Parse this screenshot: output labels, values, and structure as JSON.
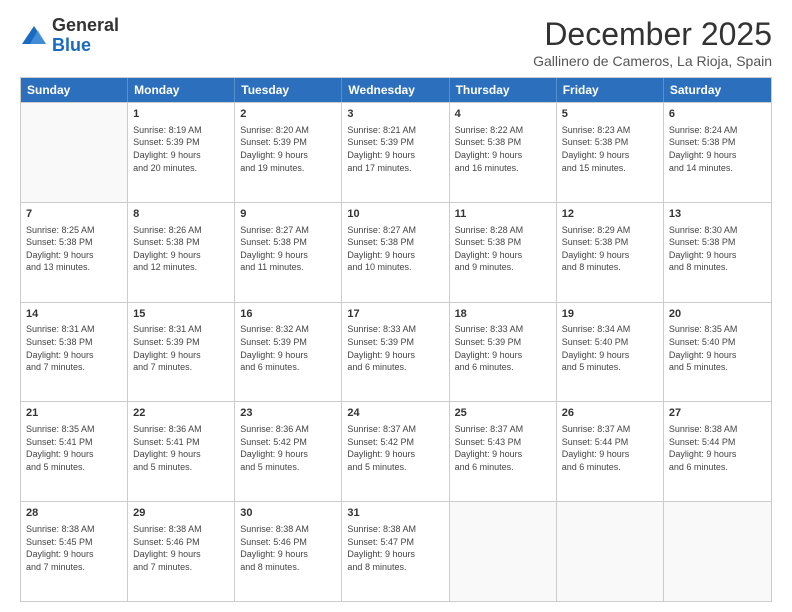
{
  "logo": {
    "general": "General",
    "blue": "Blue"
  },
  "title": "December 2025",
  "subtitle": "Gallinero de Cameros, La Rioja, Spain",
  "header_days": [
    "Sunday",
    "Monday",
    "Tuesday",
    "Wednesday",
    "Thursday",
    "Friday",
    "Saturday"
  ],
  "weeks": [
    [
      {
        "day": "",
        "info": ""
      },
      {
        "day": "1",
        "info": "Sunrise: 8:19 AM\nSunset: 5:39 PM\nDaylight: 9 hours\nand 20 minutes."
      },
      {
        "day": "2",
        "info": "Sunrise: 8:20 AM\nSunset: 5:39 PM\nDaylight: 9 hours\nand 19 minutes."
      },
      {
        "day": "3",
        "info": "Sunrise: 8:21 AM\nSunset: 5:39 PM\nDaylight: 9 hours\nand 17 minutes."
      },
      {
        "day": "4",
        "info": "Sunrise: 8:22 AM\nSunset: 5:38 PM\nDaylight: 9 hours\nand 16 minutes."
      },
      {
        "day": "5",
        "info": "Sunrise: 8:23 AM\nSunset: 5:38 PM\nDaylight: 9 hours\nand 15 minutes."
      },
      {
        "day": "6",
        "info": "Sunrise: 8:24 AM\nSunset: 5:38 PM\nDaylight: 9 hours\nand 14 minutes."
      }
    ],
    [
      {
        "day": "7",
        "info": "Sunrise: 8:25 AM\nSunset: 5:38 PM\nDaylight: 9 hours\nand 13 minutes."
      },
      {
        "day": "8",
        "info": "Sunrise: 8:26 AM\nSunset: 5:38 PM\nDaylight: 9 hours\nand 12 minutes."
      },
      {
        "day": "9",
        "info": "Sunrise: 8:27 AM\nSunset: 5:38 PM\nDaylight: 9 hours\nand 11 minutes."
      },
      {
        "day": "10",
        "info": "Sunrise: 8:27 AM\nSunset: 5:38 PM\nDaylight: 9 hours\nand 10 minutes."
      },
      {
        "day": "11",
        "info": "Sunrise: 8:28 AM\nSunset: 5:38 PM\nDaylight: 9 hours\nand 9 minutes."
      },
      {
        "day": "12",
        "info": "Sunrise: 8:29 AM\nSunset: 5:38 PM\nDaylight: 9 hours\nand 8 minutes."
      },
      {
        "day": "13",
        "info": "Sunrise: 8:30 AM\nSunset: 5:38 PM\nDaylight: 9 hours\nand 8 minutes."
      }
    ],
    [
      {
        "day": "14",
        "info": "Sunrise: 8:31 AM\nSunset: 5:38 PM\nDaylight: 9 hours\nand 7 minutes."
      },
      {
        "day": "15",
        "info": "Sunrise: 8:31 AM\nSunset: 5:39 PM\nDaylight: 9 hours\nand 7 minutes."
      },
      {
        "day": "16",
        "info": "Sunrise: 8:32 AM\nSunset: 5:39 PM\nDaylight: 9 hours\nand 6 minutes."
      },
      {
        "day": "17",
        "info": "Sunrise: 8:33 AM\nSunset: 5:39 PM\nDaylight: 9 hours\nand 6 minutes."
      },
      {
        "day": "18",
        "info": "Sunrise: 8:33 AM\nSunset: 5:39 PM\nDaylight: 9 hours\nand 6 minutes."
      },
      {
        "day": "19",
        "info": "Sunrise: 8:34 AM\nSunset: 5:40 PM\nDaylight: 9 hours\nand 5 minutes."
      },
      {
        "day": "20",
        "info": "Sunrise: 8:35 AM\nSunset: 5:40 PM\nDaylight: 9 hours\nand 5 minutes."
      }
    ],
    [
      {
        "day": "21",
        "info": "Sunrise: 8:35 AM\nSunset: 5:41 PM\nDaylight: 9 hours\nand 5 minutes."
      },
      {
        "day": "22",
        "info": "Sunrise: 8:36 AM\nSunset: 5:41 PM\nDaylight: 9 hours\nand 5 minutes."
      },
      {
        "day": "23",
        "info": "Sunrise: 8:36 AM\nSunset: 5:42 PM\nDaylight: 9 hours\nand 5 minutes."
      },
      {
        "day": "24",
        "info": "Sunrise: 8:37 AM\nSunset: 5:42 PM\nDaylight: 9 hours\nand 5 minutes."
      },
      {
        "day": "25",
        "info": "Sunrise: 8:37 AM\nSunset: 5:43 PM\nDaylight: 9 hours\nand 6 minutes."
      },
      {
        "day": "26",
        "info": "Sunrise: 8:37 AM\nSunset: 5:44 PM\nDaylight: 9 hours\nand 6 minutes."
      },
      {
        "day": "27",
        "info": "Sunrise: 8:38 AM\nSunset: 5:44 PM\nDaylight: 9 hours\nand 6 minutes."
      }
    ],
    [
      {
        "day": "28",
        "info": "Sunrise: 8:38 AM\nSunset: 5:45 PM\nDaylight: 9 hours\nand 7 minutes."
      },
      {
        "day": "29",
        "info": "Sunrise: 8:38 AM\nSunset: 5:46 PM\nDaylight: 9 hours\nand 7 minutes."
      },
      {
        "day": "30",
        "info": "Sunrise: 8:38 AM\nSunset: 5:46 PM\nDaylight: 9 hours\nand 8 minutes."
      },
      {
        "day": "31",
        "info": "Sunrise: 8:38 AM\nSunset: 5:47 PM\nDaylight: 9 hours\nand 8 minutes."
      },
      {
        "day": "",
        "info": ""
      },
      {
        "day": "",
        "info": ""
      },
      {
        "day": "",
        "info": ""
      }
    ]
  ]
}
